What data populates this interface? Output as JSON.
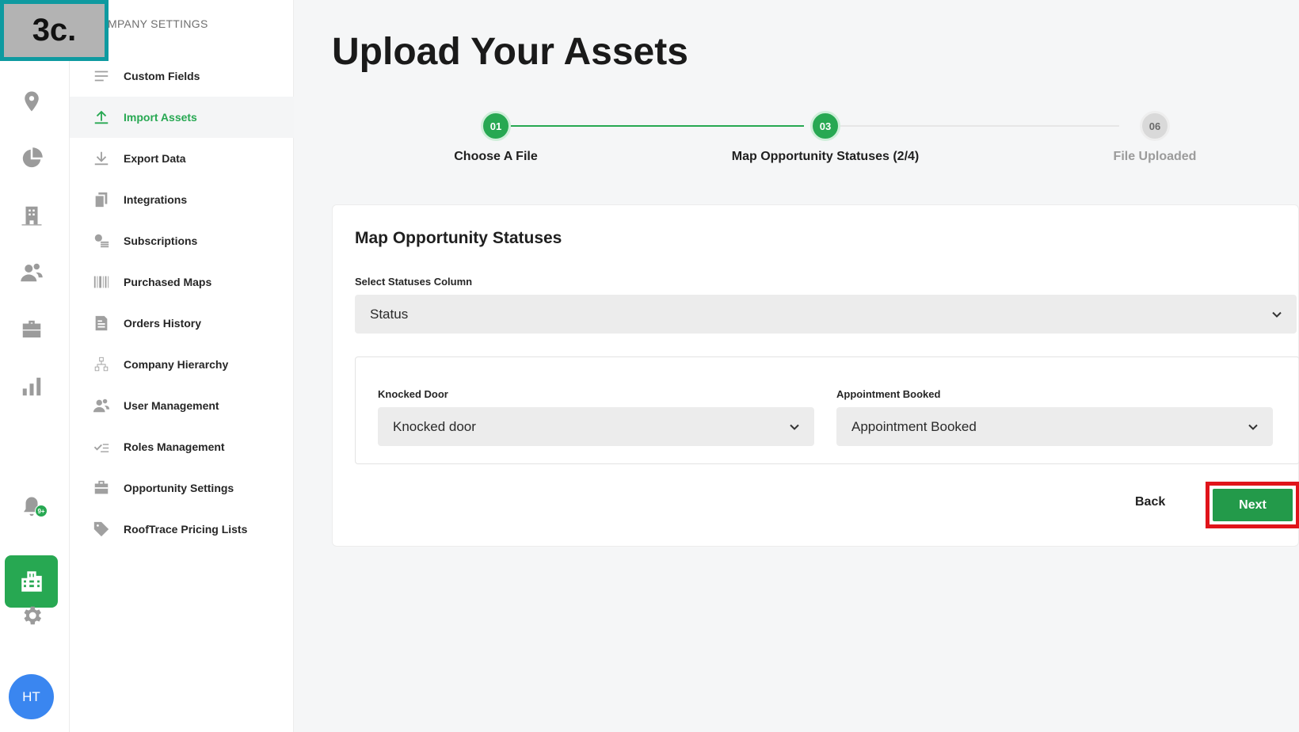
{
  "step_tag": "3c.",
  "sidebar": {
    "heading": "MPANY SETTINGS",
    "items": [
      {
        "label": "Custom Fields",
        "icon": "list-lines-icon"
      },
      {
        "label": "Import Assets",
        "icon": "upload-arrow-icon",
        "active": true
      },
      {
        "label": "Export Data",
        "icon": "download-arrow-icon"
      },
      {
        "label": "Integrations",
        "icon": "stacked-pages-icon"
      },
      {
        "label": "Subscriptions",
        "icon": "coins-icon"
      },
      {
        "label": "Purchased Maps",
        "icon": "barcode-map-icon"
      },
      {
        "label": "Orders History",
        "icon": "receipt-icon"
      },
      {
        "label": "Company Hierarchy",
        "icon": "org-chart-icon"
      },
      {
        "label": "User Management",
        "icon": "users-icon"
      },
      {
        "label": "Roles Management",
        "icon": "checklist-icon"
      },
      {
        "label": "Opportunity Settings",
        "icon": "briefcase-icon"
      },
      {
        "label": "RoofTrace Pricing Lists",
        "icon": "tag-icon"
      }
    ]
  },
  "rail": {
    "icons": [
      "location-pin-icon",
      "pie-chart-icon",
      "building-icon",
      "team-icon",
      "briefcase-icon",
      "bar-chart-icon",
      "bell-icon",
      "company-icon",
      "gear-icon"
    ],
    "notification_badge": "9+",
    "avatar_initials": "HT"
  },
  "main": {
    "title": "Upload Your Assets",
    "steps": [
      {
        "number": "01",
        "label": "Choose A File",
        "status": "done"
      },
      {
        "number": "03",
        "label": "Map Opportunity Statuses (2/4)",
        "status": "current"
      },
      {
        "number": "06",
        "label": "File Uploaded",
        "status": "todo"
      }
    ],
    "card": {
      "title": "Map Opportunity Statuses",
      "statuses_column_label": "Select Statuses Column",
      "statuses_column_value": "Status",
      "mappings": [
        {
          "label": "Knocked Door",
          "value": "Knocked door"
        },
        {
          "label": "Appointment Booked",
          "value": "Appointment Booked"
        }
      ],
      "back_label": "Back",
      "next_label": "Next"
    }
  },
  "colors": {
    "brand_green": "#27a852",
    "highlight_red": "#e0141a",
    "avatar_blue": "#3a86f0",
    "tag_teal": "#0e9aa0"
  }
}
